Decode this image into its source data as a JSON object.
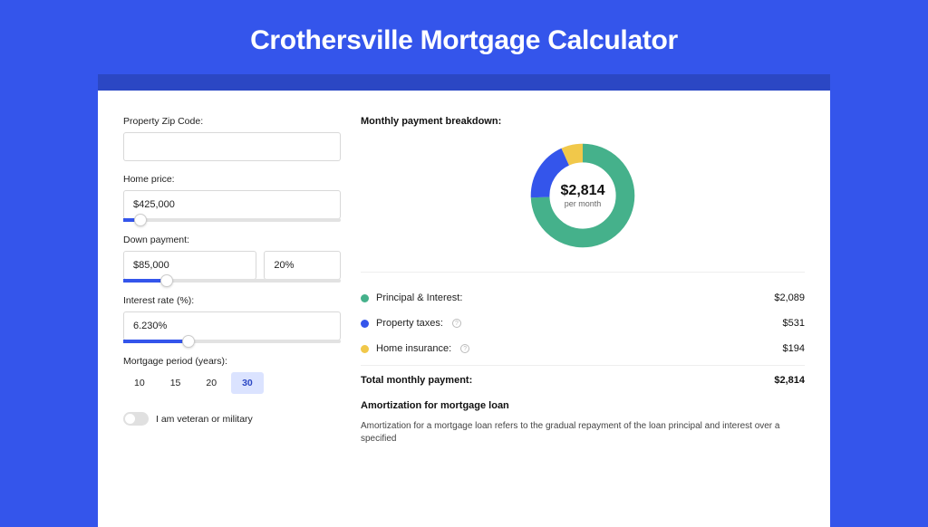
{
  "title": "Crothersville Mortgage Calculator",
  "form": {
    "zip": {
      "label": "Property Zip Code:",
      "value": ""
    },
    "price": {
      "label": "Home price:",
      "value": "$425,000",
      "slider_pct": 8
    },
    "down": {
      "label": "Down payment:",
      "amount": "$85,000",
      "pct": "20%",
      "slider_pct": 20
    },
    "rate": {
      "label": "Interest rate (%):",
      "value": "6.230%",
      "slider_pct": 30
    },
    "period": {
      "label": "Mortgage period (years):",
      "options": [
        "10",
        "15",
        "20",
        "30"
      ],
      "selected": "30"
    },
    "veteran": {
      "label": "I am veteran or military"
    }
  },
  "breakdown": {
    "title": "Monthly payment breakdown:",
    "center_amount": "$2,814",
    "center_sub": "per month",
    "rows": [
      {
        "label": "Principal & Interest:",
        "value": "$2,089",
        "color": "#45b18b",
        "info": false
      },
      {
        "label": "Property taxes:",
        "value": "$531",
        "color": "#3455eb",
        "info": true
      },
      {
        "label": "Home insurance:",
        "value": "$194",
        "color": "#f1c84a",
        "info": true
      }
    ],
    "total_label": "Total monthly payment:",
    "total_value": "$2,814"
  },
  "amort": {
    "title": "Amortization for mortgage loan",
    "text": "Amortization for a mortgage loan refers to the gradual repayment of the loan principal and interest over a specified"
  },
  "chart_data": {
    "type": "pie",
    "title": "Monthly payment breakdown",
    "series": [
      {
        "name": "Principal & Interest",
        "value": 2089,
        "color": "#45b18b"
      },
      {
        "name": "Property taxes",
        "value": 531,
        "color": "#3455eb"
      },
      {
        "name": "Home insurance",
        "value": 194,
        "color": "#f1c84a"
      }
    ],
    "total": 2814,
    "center_label": "$2,814 per month"
  }
}
